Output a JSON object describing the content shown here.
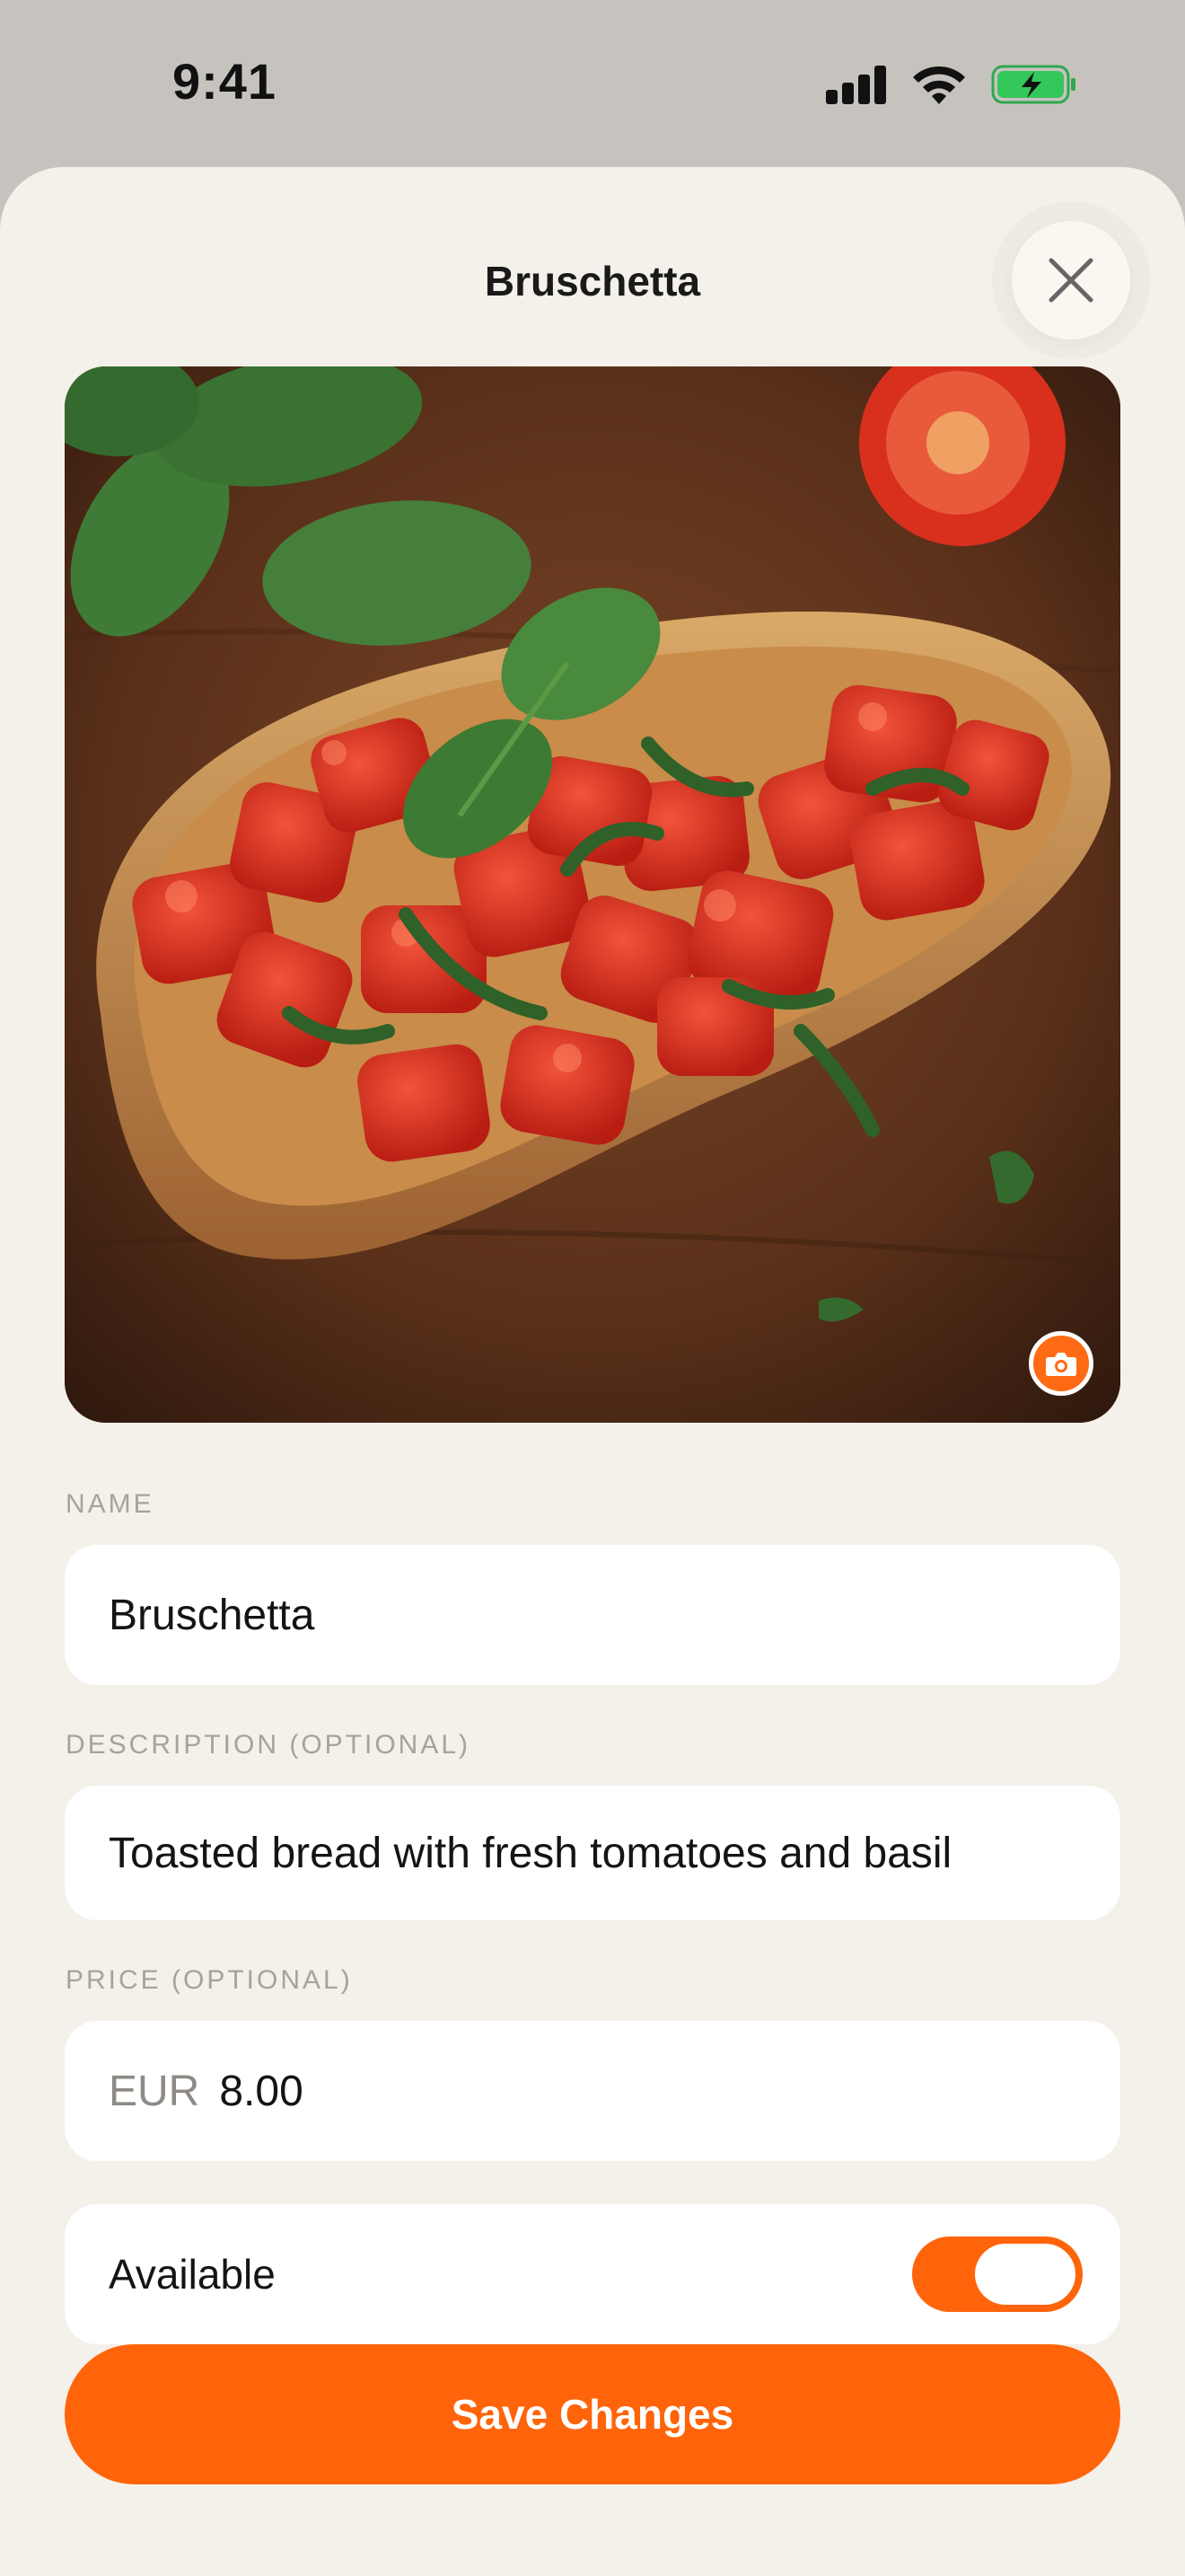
{
  "status_bar": {
    "time": "9:41",
    "icons": [
      "signal-icon",
      "wifi-icon",
      "battery-charging-icon"
    ],
    "battery_color": "#34c759"
  },
  "sheet": {
    "title": "Bruschetta",
    "close_icon": "close-icon"
  },
  "photo": {
    "subject": "bruschetta",
    "camera_icon": "camera-icon"
  },
  "form": {
    "name": {
      "label": "NAME",
      "value": "Bruschetta"
    },
    "description": {
      "label": "DESCRIPTION (OPTIONAL)",
      "value": "Toasted bread with fresh tomatoes and basil"
    },
    "price": {
      "label": "PRICE (OPTIONAL)",
      "currency": "EUR",
      "value": "8.00"
    },
    "available": {
      "label": "Available",
      "on": true
    }
  },
  "actions": {
    "save_label": "Save Changes"
  },
  "colors": {
    "accent": "#ff640a",
    "sheet_background": "#f4f0ea",
    "field_background": "#ffffff",
    "label_gray": "#a7a29b"
  }
}
